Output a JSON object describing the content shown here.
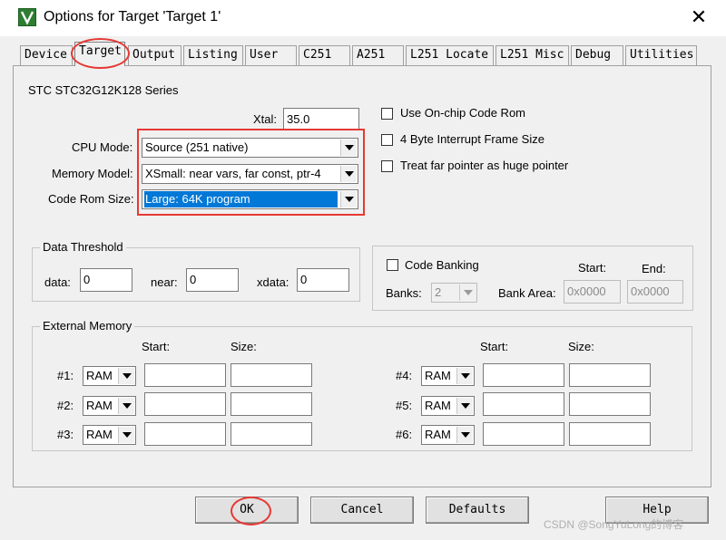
{
  "window": {
    "title": "Options for Target 'Target 1'",
    "close_glyph": "✕"
  },
  "tabs": [
    {
      "label": "Device"
    },
    {
      "label": "Target"
    },
    {
      "label": "Output"
    },
    {
      "label": "Listing"
    },
    {
      "label": "User"
    },
    {
      "label": "C251"
    },
    {
      "label": "A251"
    },
    {
      "label": "L251 Locate"
    },
    {
      "label": "L251 Misc"
    },
    {
      "label": "Debug"
    },
    {
      "label": "Utilities"
    }
  ],
  "target": {
    "device_series": "STC STC32G12K128 Series",
    "xtal_label": "Xtal:",
    "xtal_value": "35.0",
    "cpu_mode_label": "CPU Mode:",
    "cpu_mode_value": "Source (251 native)",
    "memory_model_label": "Memory Model:",
    "memory_model_value": "XSmall: near vars, far const, ptr-4",
    "code_rom_size_label": "Code Rom Size:",
    "code_rom_size_value": "Large: 64K program",
    "use_onchip_rom_label": "Use On-chip Code Rom",
    "interrupt_frame_label": "4 Byte Interrupt Frame Size",
    "far_pointer_label": "Treat far pointer as huge pointer"
  },
  "data_threshold": {
    "title": "Data Threshold",
    "data_label": "data:",
    "data_value": "0",
    "near_label": "near:",
    "near_value": "0",
    "xdata_label": "xdata:",
    "xdata_value": "0"
  },
  "code_banking": {
    "label": "Code Banking",
    "banks_label": "Banks:",
    "banks_value": "2",
    "bank_area_label": "Bank Area:",
    "start_label": "Start:",
    "end_label": "End:",
    "start_value": "0x0000",
    "end_value": "0x0000"
  },
  "external_memory": {
    "title": "External Memory",
    "start_label": "Start:",
    "size_label": "Size:",
    "rows": [
      {
        "label": "#1:",
        "type": "RAM"
      },
      {
        "label": "#2:",
        "type": "RAM"
      },
      {
        "label": "#3:",
        "type": "RAM"
      },
      {
        "label": "#4:",
        "type": "RAM"
      },
      {
        "label": "#5:",
        "type": "RAM"
      },
      {
        "label": "#6:",
        "type": "RAM"
      }
    ]
  },
  "buttons": {
    "ok": "OK",
    "cancel": "Cancel",
    "defaults": "Defaults",
    "help": "Help"
  },
  "watermark": "CSDN @SongYuLong的博客",
  "colors": {
    "highlight": "#e53935",
    "selection": "#0078d7",
    "app_icon": "#2e7d32"
  }
}
